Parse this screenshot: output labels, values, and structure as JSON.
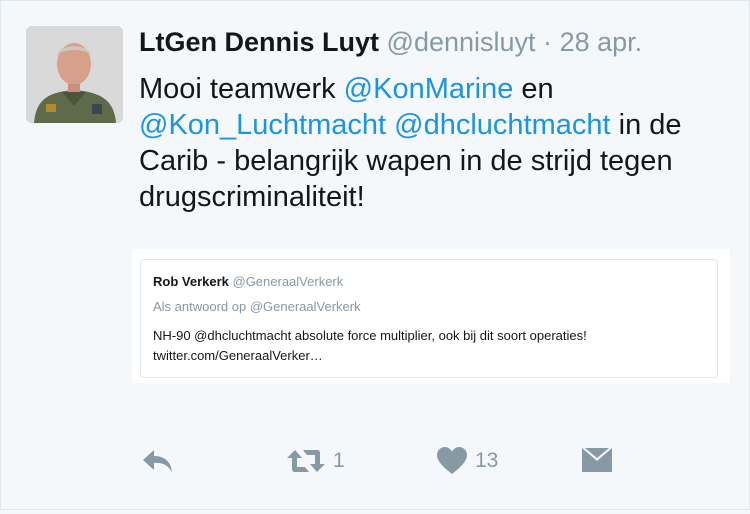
{
  "tweet": {
    "author_name": "LtGen Dennis Luyt",
    "author_handle": "@dennisluyt",
    "separator": "·",
    "date": "28 apr.",
    "text_parts": {
      "p1": "Mooi teamwerk ",
      "m1": "@KonMarine",
      "p2": " en ",
      "m2": "@Kon_Luchtmacht",
      "p3": " ",
      "m3": "@dhcluchtmacht",
      "p4": " in de Carib - belangrijk wapen in de strijd tegen drugscriminaliteit!"
    },
    "colors": {
      "mention": "#1b95e0",
      "muted": "#8899a6",
      "text": "#14171a"
    }
  },
  "quote": {
    "author_name": "Rob Verkerk",
    "author_handle": "@GeneraalVerkerk",
    "reply_to": "Als antwoord op @GeneraalVerkerk",
    "text": "NH-90 @dhcluchtmacht absolute force multiplier, ook bij dit soort operaties! twitter.com/GeneraalVerker…"
  },
  "actions": {
    "reply_icon": "reply-icon",
    "retweet_icon": "retweet-icon",
    "retweet_count": "1",
    "like_icon": "heart-icon",
    "like_count": "13",
    "dm_icon": "envelope-icon"
  }
}
